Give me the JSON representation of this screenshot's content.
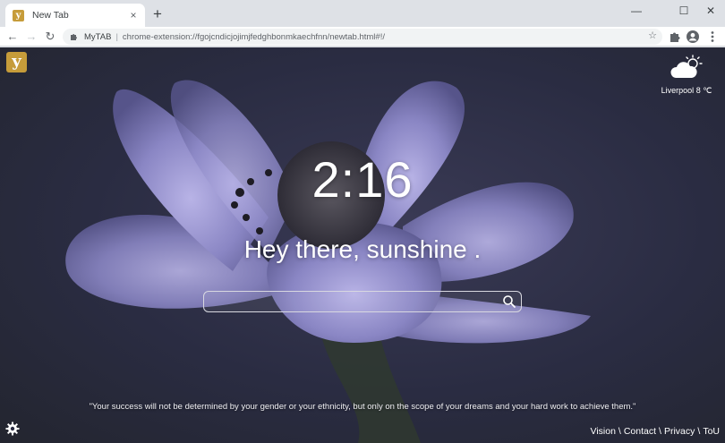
{
  "browser": {
    "tab_title": "New Tab",
    "tab_close": "×",
    "new_tab": "+",
    "window_controls": {
      "minimize": "—",
      "maximize": "☐",
      "close": "✕"
    },
    "nav": {
      "back": "←",
      "forward": "→",
      "reload": "↻"
    },
    "omnibox": {
      "site_name": "MyTAB",
      "separator": "|",
      "url": "chrome-extension://fgojcndicjojimjfedghbonmkaechfnn/newtab.html#!/"
    },
    "icons": [
      "star-icon",
      "extensions-icon",
      "profile-icon",
      "menu-icon"
    ]
  },
  "page": {
    "logo_letter": "y",
    "weather": {
      "location": "Liverpool",
      "temperature": "8 ℃",
      "icon": "partly-cloudy-icon"
    },
    "clock": "2:16",
    "greeting": "Hey there, sunshine .",
    "search": {
      "value": "",
      "placeholder": ""
    },
    "quote": "\"Your success will not be determined by your gender or your ethnicity, but only on the scope of your dreams and your hard work to achieve them.\"",
    "footer_links": [
      "Vision",
      "Contact",
      "Privacy",
      "ToU"
    ],
    "footer_separator": "\\"
  },
  "colors": {
    "brand": "#c69c3a",
    "background_dark": "#2a2c42",
    "petal": "#8a86c4"
  }
}
